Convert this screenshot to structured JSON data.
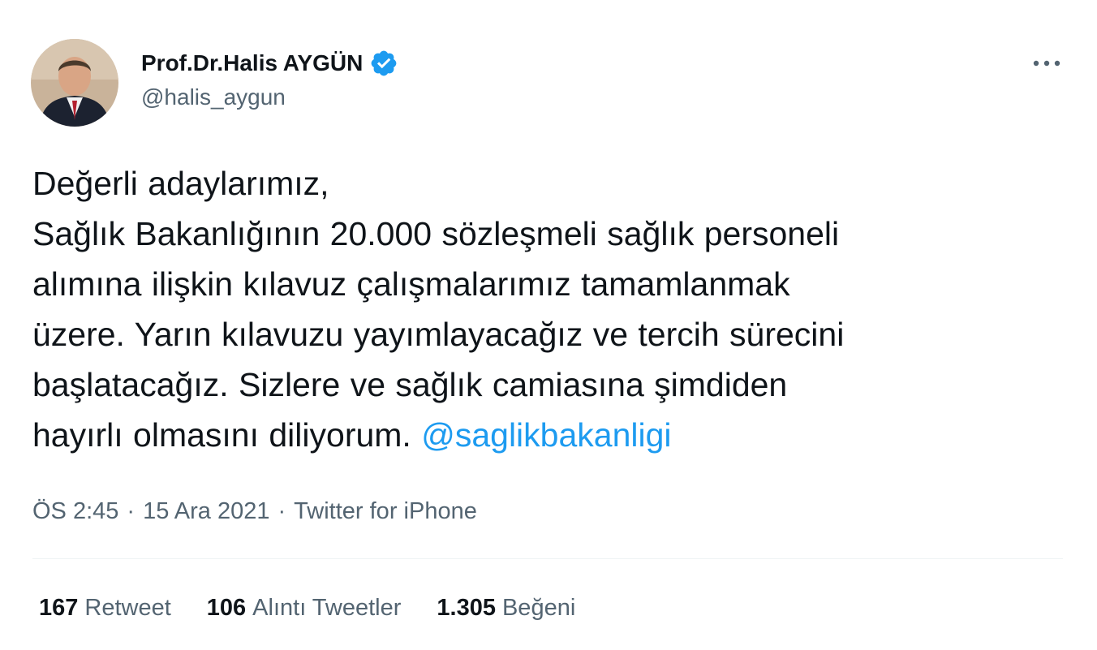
{
  "author": {
    "display_name": "Prof.Dr.Halis AYGÜN",
    "handle": "@halis_aygun",
    "verified_icon": "verified-badge-icon",
    "avatar_icon": "profile-photo"
  },
  "tweet": {
    "text_lines": [
      "Değerli adaylarımız,",
      "Sağlık Bakanlığının 20.000 sözleşmeli sağlık personeli",
      "alımına ilişkin kılavuz çalışmalarımız tamamlanmak",
      "üzere. Yarın kılavuzu yayımlayacağız ve tercih sürecini",
      "başlatacağız. Sizlere ve sağlık camiasına şimdiden",
      "hayırlı olmasını diliyorum. "
    ],
    "mention": "@saglikbakanligi"
  },
  "meta": {
    "time": "ÖS 2:45",
    "separator": "·",
    "date": "15 Ara 2021",
    "source": "Twitter for iPhone"
  },
  "stats": {
    "retweets": {
      "count": "167",
      "label": "Retweet"
    },
    "quotes": {
      "count": "106",
      "label": "Alıntı Tweetler"
    },
    "likes": {
      "count": "1.305",
      "label": "Beğeni"
    }
  },
  "colors": {
    "accent": "#1d9bf0",
    "text_primary": "#0f1419",
    "text_secondary": "#536471",
    "divider": "#eff3f4"
  }
}
